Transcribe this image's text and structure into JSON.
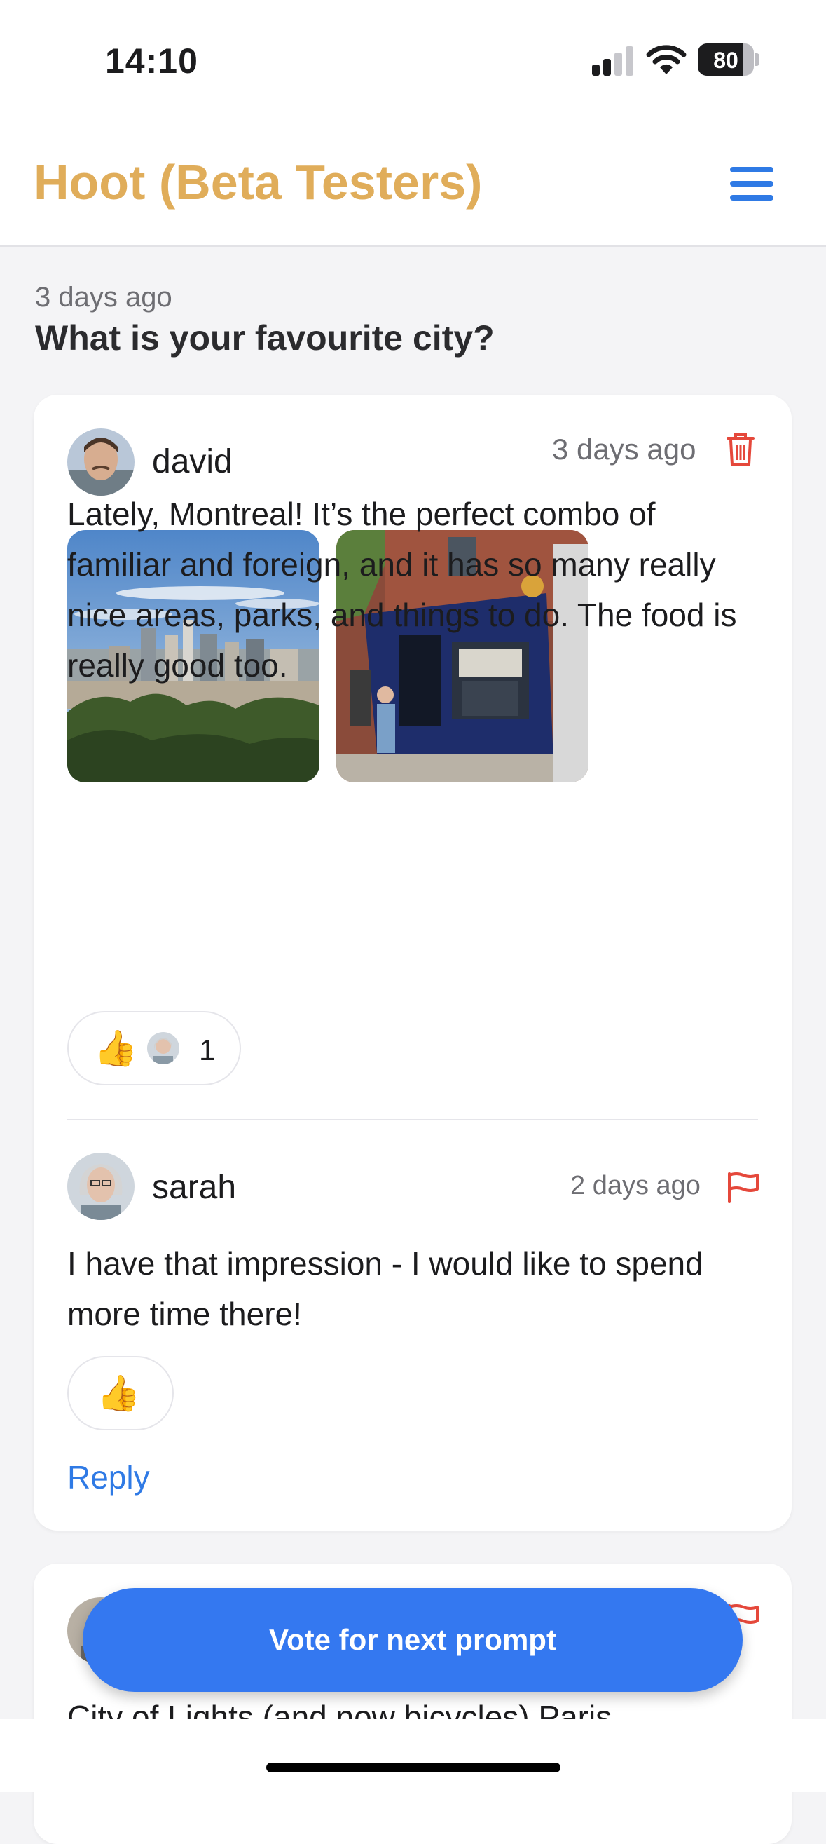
{
  "status_bar": {
    "time": "14:10",
    "battery": "80",
    "battery_level": 0.8,
    "signal_bars": 2,
    "icons": [
      "cellular-signal-icon",
      "wifi-icon",
      "battery-icon"
    ]
  },
  "header": {
    "title": "Hoot (Beta Testers)",
    "title_color": "#E0AD5A",
    "menu_icon": "hamburger-menu-icon",
    "accent_color": "#2F7AE5"
  },
  "prompt": {
    "time": "3 days ago",
    "question": "What is your favourite city?"
  },
  "post": {
    "author": "david",
    "time": "3 days ago",
    "delete_icon": "trash-icon",
    "photos": [
      "montreal-skyline-photo",
      "montreal-storefront-photo"
    ],
    "body": "Lately, Montreal! It’s the perfect combo of familiar and foreign, and it has so many really nice areas, parks, and things to do. The food is really good too.",
    "reaction": {
      "emoji": "👍",
      "count": "1"
    }
  },
  "comment": {
    "author": "sarah",
    "time": "2 days ago",
    "flag_icon": "flag-icon",
    "body": "I have that impression - I would like to spend more time there!",
    "reaction_emoji": "👍",
    "reply_label": "Reply"
  },
  "next_post": {
    "body_preview": "City of Lights (and now bicycles) Paris"
  },
  "vote_button": {
    "label": "Vote for next prompt",
    "color": "#3478F0"
  }
}
